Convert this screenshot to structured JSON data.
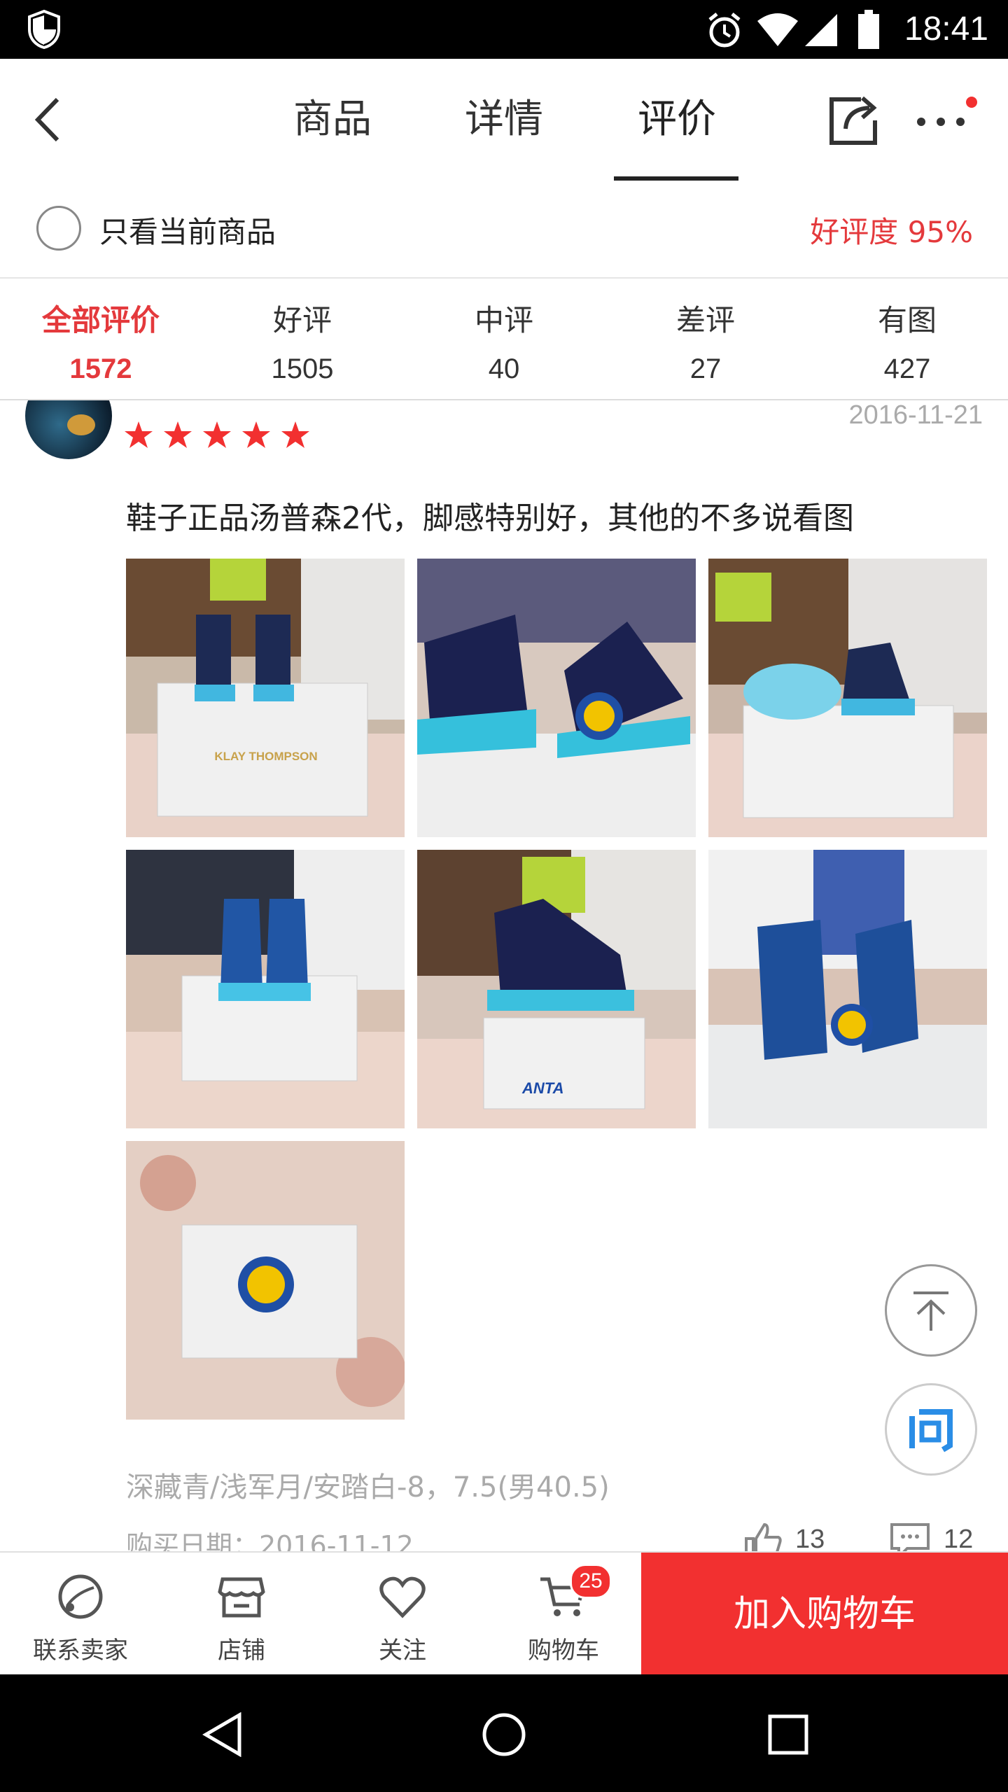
{
  "status_bar": {
    "time": "18:41"
  },
  "header": {
    "tabs": [
      {
        "label": "商品"
      },
      {
        "label": "详情"
      },
      {
        "label": "评价"
      }
    ]
  },
  "filter": {
    "only_current_label": "只看当前商品",
    "rating_label": "好评度 95%"
  },
  "stats": [
    {
      "label": "全部评价",
      "count": "1572"
    },
    {
      "label": "好评",
      "count": "1505"
    },
    {
      "label": "中评",
      "count": "40"
    },
    {
      "label": "差评",
      "count": "27"
    },
    {
      "label": "有图",
      "count": "427"
    }
  ],
  "review": {
    "date": "2016-11-21",
    "stars": 5,
    "text": "鞋子正品汤普森2代，脚感特别好，其他的不多说看图",
    "photo_box_text_1": "KLAY THOMPSON",
    "photo_box_text_2": "ANTA",
    "sku": "深藏青/浅军月/安踏白-8，7.5(男40.5)",
    "purchase_date": "购买日期：2016-11-12",
    "likes": "13",
    "comments": "12"
  },
  "bottom_bar": {
    "contact_label": "联系卖家",
    "shop_label": "店铺",
    "follow_label": "关注",
    "cart_label": "购物车",
    "cart_badge": "25",
    "add_to_cart_label": "加入购物车"
  },
  "colors": {
    "accent": "#e4393c",
    "accent_button": "#f23030"
  }
}
